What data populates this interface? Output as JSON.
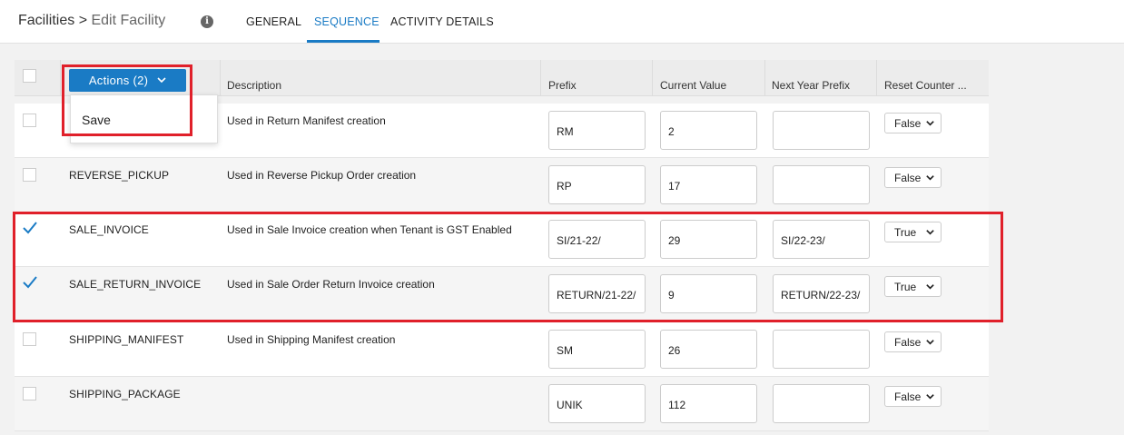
{
  "breadcrumb": {
    "root": "Facilities",
    "sep": ">",
    "current": "Edit Facility"
  },
  "info_glyph": "i",
  "tabs": [
    {
      "label": "GENERAL",
      "active": false
    },
    {
      "label": "SEQUENCE",
      "active": true
    },
    {
      "label": "ACTIVITY DETAILS",
      "active": false
    }
  ],
  "accent_color": "#1a7bc5",
  "highlight_color": "#e0202a",
  "actions": {
    "label": "Actions (2)",
    "menu": [
      "Save"
    ]
  },
  "columns": [
    "Description",
    "Prefix",
    "Current Value",
    "Next Year Prefix",
    "Reset Counter ..."
  ],
  "rows": [
    {
      "checked": false,
      "name": "",
      "description": "Used in Return Manifest creation",
      "prefix": "RM",
      "current_value": "2",
      "next_year_prefix": "",
      "reset_counter": "False"
    },
    {
      "checked": false,
      "name": "REVERSE_PICKUP",
      "description": "Used in Reverse Pickup Order creation",
      "prefix": "RP",
      "current_value": "17",
      "next_year_prefix": "",
      "reset_counter": "False"
    },
    {
      "checked": true,
      "name": "SALE_INVOICE",
      "description": "Used in Sale Invoice creation when Tenant is GST Enabled",
      "prefix": "SI/21-22/",
      "current_value": "29",
      "next_year_prefix": "SI/22-23/",
      "reset_counter": "True"
    },
    {
      "checked": true,
      "name": "SALE_RETURN_INVOICE",
      "description": "Used in Sale Order Return Invoice creation",
      "prefix": "RETURN/21-22/",
      "current_value": "9",
      "next_year_prefix": "RETURN/22-23/",
      "reset_counter": "True"
    },
    {
      "checked": false,
      "name": "SHIPPING_MANIFEST",
      "description": "Used in Shipping Manifest creation",
      "prefix": "SM",
      "current_value": "26",
      "next_year_prefix": "",
      "reset_counter": "False"
    },
    {
      "checked": false,
      "name": "SHIPPING_PACKAGE",
      "description": "",
      "prefix": "UNIK",
      "current_value": "112",
      "next_year_prefix": "",
      "reset_counter": "False"
    }
  ]
}
